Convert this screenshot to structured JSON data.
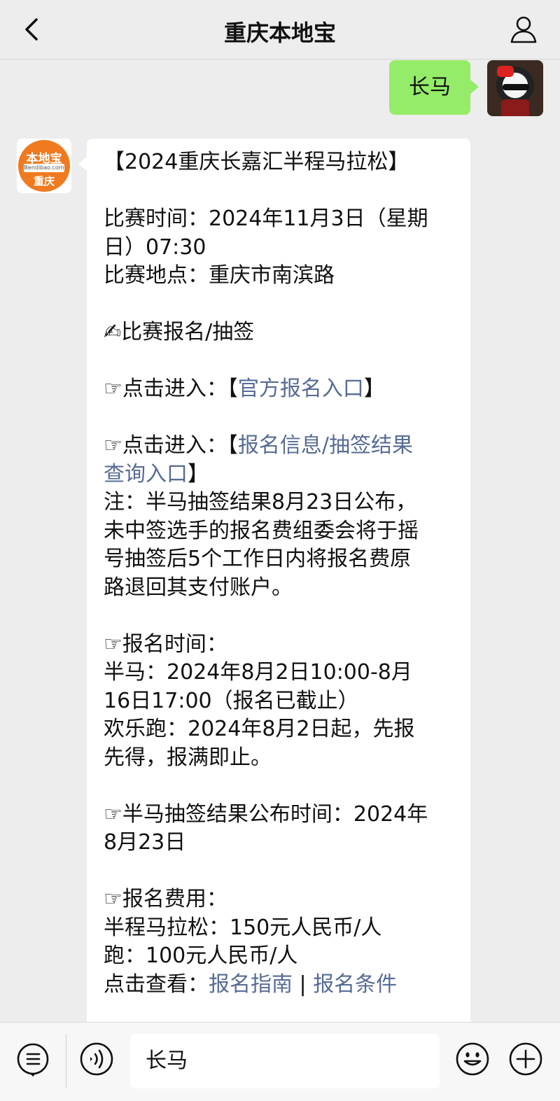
{
  "header": {
    "title": "重庆本地宝"
  },
  "sent_message": {
    "text": "长马"
  },
  "account_avatar": {
    "top_text": "本地宝",
    "middle_text": "Bendibao.com",
    "bottom_text": "重庆"
  },
  "reply": {
    "l01": "【2024重庆长嘉汇半程马拉松】",
    "l02": "比赛时间：2024年11月3日（星期",
    "l03": "日）07:30",
    "l04": "比赛地点：重庆市南滨路",
    "l05_icon": "✍",
    "l05": "比赛报名/抽签",
    "l06_prefix": "☞点击进入：【",
    "l06_link": "官方报名入口",
    "l06_suffix": "】",
    "l07_prefix": "☞点击进入：【",
    "l07_link_a": "报名信息/抽签结果",
    "l08_link_b": "查询入口",
    "l08_suffix": "】",
    "l09": "注：半马抽签结果8月23日公布，",
    "l10": "未中签选手的报名费组委会将于摇",
    "l11": "号抽签后5个工作日内将报名费原",
    "l12": "路退回其支付账户。",
    "l13": "☞报名时间：",
    "l14": "半马：2024年8月2日10:00-8月",
    "l15": "16日17:00（报名已截止）",
    "l16": "欢乐跑：2024年8月2日起，先报",
    "l17": "先得，报满即止。",
    "l18": "☞半马抽签结果公布时间：2024年",
    "l19": "8月23日",
    "l20": "☞报名费用：",
    "l21": "半程马拉松：150元人民币/人",
    "l22": "跑：100元人民币/人",
    "l23_prefix": "点击查看：",
    "l23_link_a": "报名指南",
    "l23_sep": " | ",
    "l23_link_b": "报名条件"
  },
  "input_bar": {
    "value": "长马"
  },
  "colors": {
    "link": "#576b95",
    "sent_bubble": "#95ec69",
    "brand_orange": "#f07a1f"
  }
}
